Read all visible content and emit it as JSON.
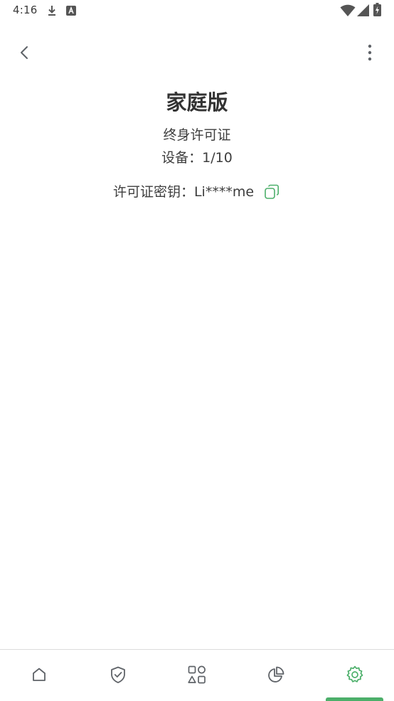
{
  "status_bar": {
    "time": "4:16",
    "icons": [
      "download-icon",
      "a-badge-icon",
      "wifi-icon",
      "signal-icon",
      "battery-charging-icon"
    ]
  },
  "toolbar": {
    "back_icon": "chevron-left-icon",
    "more_icon": "more-vert-icon"
  },
  "license": {
    "title": "家庭版",
    "type": "终身许可证",
    "devices": "设备：1/10",
    "key_label": "许可证密钥：Li****me",
    "copy_icon": "copy-icon"
  },
  "bottom_nav": {
    "items": [
      {
        "icon": "home-icon",
        "active": false
      },
      {
        "icon": "shield-check-icon",
        "active": false
      },
      {
        "icon": "apps-icon",
        "active": false
      },
      {
        "icon": "pie-chart-icon",
        "active": false
      },
      {
        "icon": "settings-gear-icon",
        "active": true
      }
    ]
  },
  "colors": {
    "accent": "#4caf6a",
    "icon_gray": "#5f6368",
    "text": "#333333",
    "divider": "#dcdcdc"
  }
}
